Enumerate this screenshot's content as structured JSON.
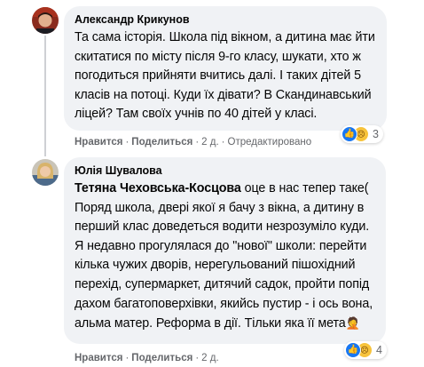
{
  "comments": [
    {
      "author": "Александр Крикунов",
      "text": "Та сама історія. Школа під вікном, а дитина має йти скитатися по місту після 9-го класу, шукати, хто ж погодиться прийняти вчитись далі. І таких дітей 5 класів на потоці. Куди їх дівати? В Скандинавський ліцей? Там своїх учнів по 40 дітей у класі.",
      "actions": {
        "like": "Нравится",
        "reply": "Поделиться",
        "time": "2 д.",
        "edited": "Отредактировано"
      },
      "reactions": {
        "icons": [
          "like-icon",
          "sad-icon"
        ],
        "count": "3"
      }
    },
    {
      "author": "Юлія Шувалова",
      "mention": "Тетяна Чеховська-Косцова",
      "text": " оце в нас тепер таке( Поряд школа, двері якої я бачу з вікна, а дитину в перший клас доведеться водити незрозуміло куди. Я недавно прогулялася до \"нової\" школи: перейти кілька чужих дворів, нерегульований пішохідний перехід, супермаркет, дитячий садок, пройти попід дахом багатоповерхівки, якийсь пустир - і ось вона, альма матер. Реформа в дії. Тільки яка її мета",
      "emoji": "🤦",
      "actions": {
        "like": "Нравится",
        "reply": "Поделиться",
        "time": "2 д."
      },
      "reactions": {
        "icons": [
          "like-icon",
          "sad-icon"
        ],
        "count": "4"
      }
    }
  ],
  "colors": {
    "bubble": "#f0f2f5",
    "meta_text": "#65676b",
    "like_blue": "#1877f2",
    "sad_yellow": "#f7c33b"
  }
}
